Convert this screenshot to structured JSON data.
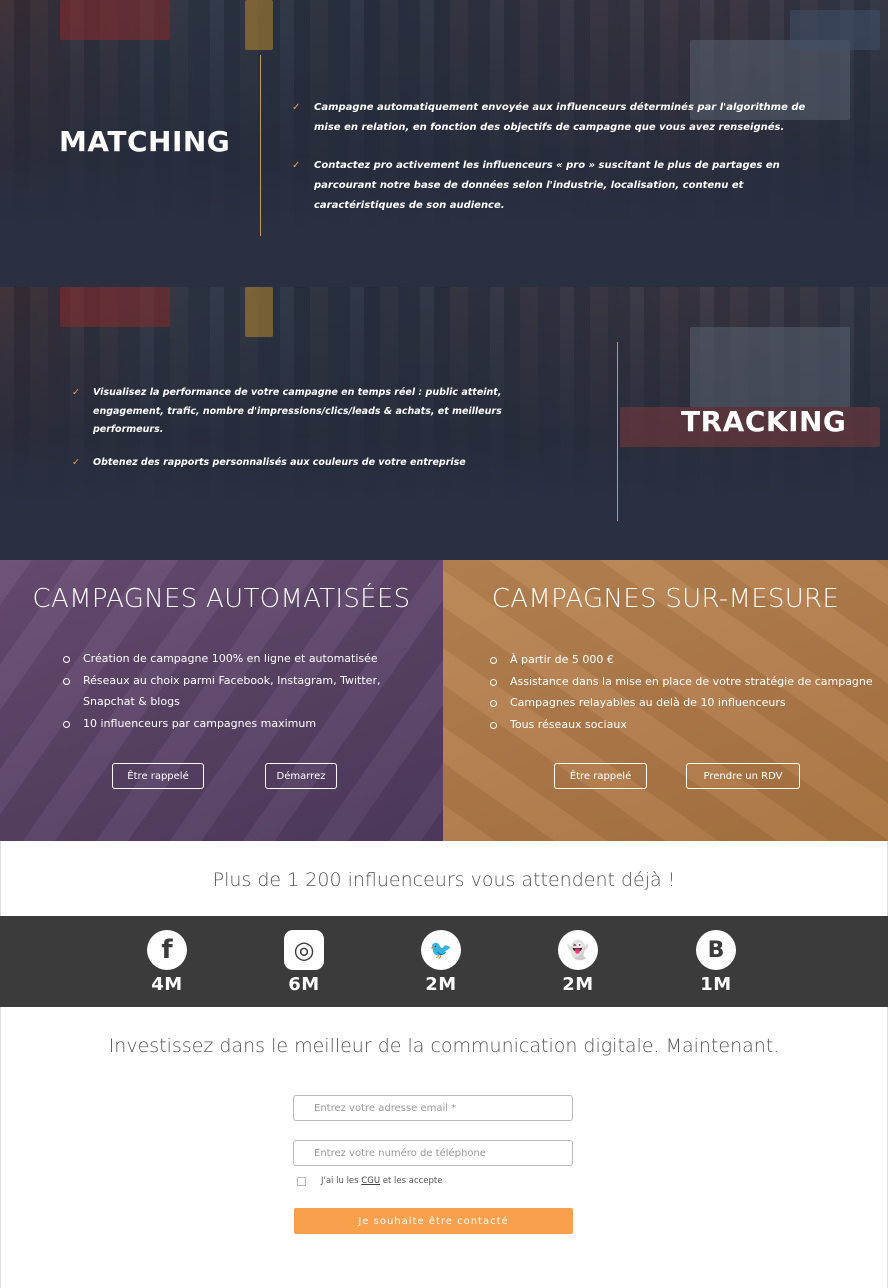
{
  "matching": {
    "title": "MATCHING",
    "items": [
      "Campagne automatiquement envoyée aux influenceurs déterminés par l'algorithme de mise en relation, en fonction des objectifs de campagne que vous avez renseignés.",
      "Contactez pro activement les influenceurs « pro » suscitant le plus de partages en parcourant notre base de données selon l'industrie, localisation, contenu et caractéristiques de son audience."
    ]
  },
  "tracking": {
    "title": "TRACKING",
    "items": [
      "Visualisez la performance de votre campagne en temps réel : public atteint, engagement, trafic, nombre d'impressions/clics/leads & achats, et meilleurs performeurs.",
      "Obtenez des rapports personnalisés aux couleurs de votre entreprise"
    ]
  },
  "campaigns": {
    "automated": {
      "title": "CAMPAGNES AUTOMATISÉES",
      "items": [
        "Création de campagne 100% en ligne et automatisée",
        "Réseaux au choix parmi Facebook, Instagram, Twitter, Snapchat & blogs",
        "10 influenceurs par campagnes maximum"
      ],
      "callback_label": "Être rappelé",
      "start_label": "Démarrez"
    },
    "custom": {
      "title": "CAMPAGNES SUR-MESURE",
      "items": [
        "À partir de 5 000 €",
        "Assistance dans la mise en place de votre stratégie de campagne",
        "Campagnes relayables au delà de 10 influenceurs",
        "Tous réseaux sociaux"
      ],
      "callback_label": "Être rappelé",
      "appointment_label": "Prendre un RDV"
    }
  },
  "headline": "Plus de 1 200 influenceurs vous attendent déjà !",
  "social": [
    {
      "network": "facebook",
      "icon": "facebook-icon",
      "glyph": "f",
      "count": "4M"
    },
    {
      "network": "instagram",
      "icon": "instagram-icon",
      "glyph": "◎",
      "count": "6M"
    },
    {
      "network": "twitter",
      "icon": "twitter-icon",
      "glyph": "🐦",
      "count": "2M"
    },
    {
      "network": "snapchat",
      "icon": "snapchat-icon",
      "glyph": "👻",
      "count": "2M"
    },
    {
      "network": "blogger",
      "icon": "blogger-icon",
      "glyph": "B",
      "count": "1M"
    }
  ],
  "contact": {
    "lead": "Investissez dans le meilleur de la communication digitale. Maintenant.",
    "email_placeholder": "Entrez votre adresse email *",
    "phone_placeholder": "Entrez votre numéro de téléphone",
    "consent_before": "J'ai lu les",
    "consent_link": "CGU",
    "consent_after": "et les accepte",
    "submit_label": "Je souhaite être contacté"
  },
  "colors": {
    "accent_orange": "#f9a04d",
    "check_orange": "#f0a050",
    "purple_panel": "#5c4468",
    "bronze_panel": "#b27b4b",
    "social_bar": "#3b3b3b"
  }
}
